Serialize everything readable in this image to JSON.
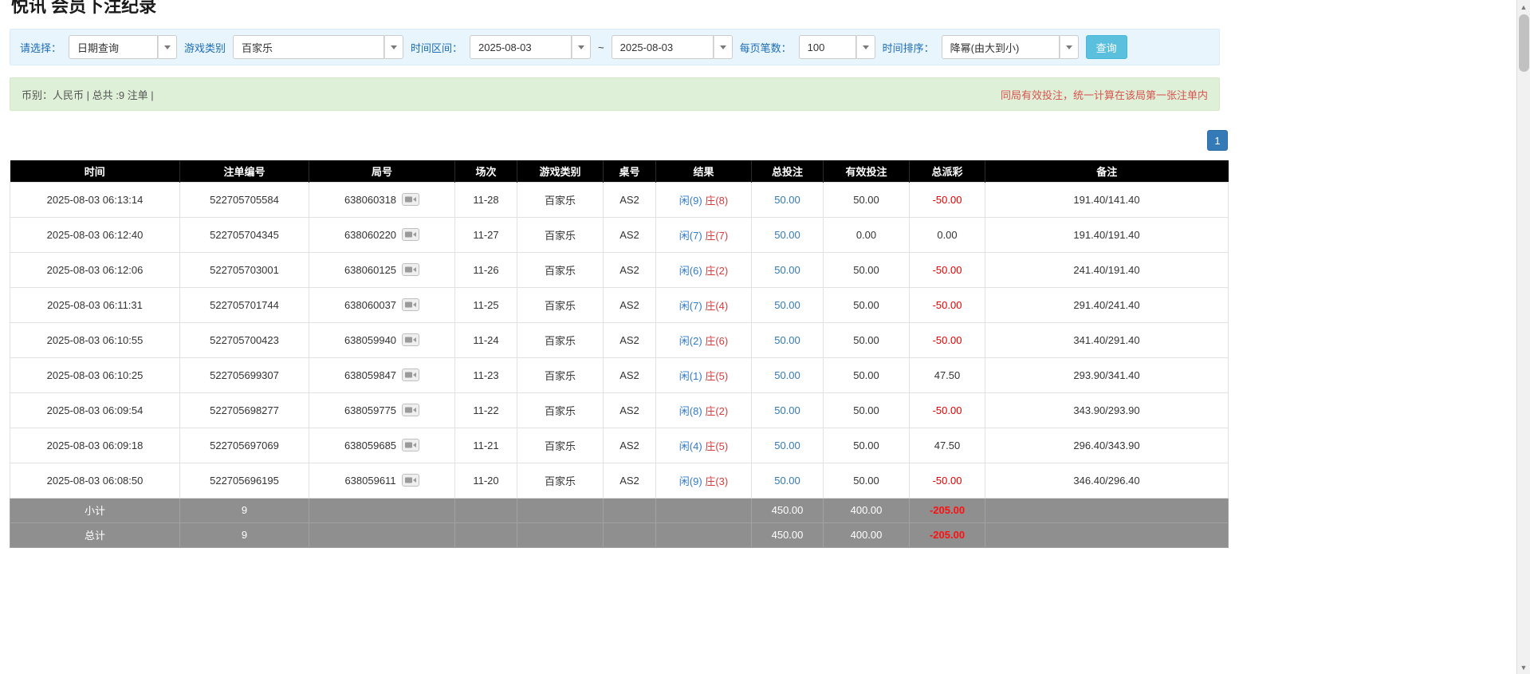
{
  "page": {
    "title": "悦讯 会员下注纪录"
  },
  "filter": {
    "select_label": "请选择：",
    "select_value": "日期查询",
    "game_label": "游戏类别",
    "game_value": "百家乐",
    "range_label": "时间区间：",
    "date_from": "2025-08-03",
    "range_separator": "~",
    "date_to": "2025-08-03",
    "page_size_label": "每页笔数：",
    "page_size_value": "100",
    "sort_label": "时间排序：",
    "sort_value": "降幂(由大到小)",
    "query_button": "查询"
  },
  "summary": {
    "info": "币别：人民币 | 总共 :9 注单 |",
    "notice": "同局有效投注，统一计算在该局第一张注单内"
  },
  "pagination": {
    "page": "1"
  },
  "table": {
    "headers": [
      "时间",
      "注单编号",
      "局号",
      "场次",
      "游戏类别",
      "桌号",
      "结果",
      "总投注",
      "有效投注",
      "总派彩",
      "备注"
    ],
    "rows": [
      {
        "time": "2025-08-03 06:13:14",
        "bet_id": "522705705584",
        "round_id": "638060318",
        "session": "11-28",
        "game": "百家乐",
        "table_id": "AS2",
        "player": "闲(9)",
        "banker": "庄(8)",
        "total_bet": "50.00",
        "valid_bet": "50.00",
        "payout": "-50.00",
        "remark": "191.40/141.40"
      },
      {
        "time": "2025-08-03 06:12:40",
        "bet_id": "522705704345",
        "round_id": "638060220",
        "session": "11-27",
        "game": "百家乐",
        "table_id": "AS2",
        "player": "闲(7)",
        "banker": "庄(7)",
        "total_bet": "50.00",
        "valid_bet": "0.00",
        "payout": "0.00",
        "remark": "191.40/191.40"
      },
      {
        "time": "2025-08-03 06:12:06",
        "bet_id": "522705703001",
        "round_id": "638060125",
        "session": "11-26",
        "game": "百家乐",
        "table_id": "AS2",
        "player": "闲(6)",
        "banker": "庄(2)",
        "total_bet": "50.00",
        "valid_bet": "50.00",
        "payout": "-50.00",
        "remark": "241.40/191.40"
      },
      {
        "time": "2025-08-03 06:11:31",
        "bet_id": "522705701744",
        "round_id": "638060037",
        "session": "11-25",
        "game": "百家乐",
        "table_id": "AS2",
        "player": "闲(7)",
        "banker": "庄(4)",
        "total_bet": "50.00",
        "valid_bet": "50.00",
        "payout": "-50.00",
        "remark": "291.40/241.40"
      },
      {
        "time": "2025-08-03 06:10:55",
        "bet_id": "522705700423",
        "round_id": "638059940",
        "session": "11-24",
        "game": "百家乐",
        "table_id": "AS2",
        "player": "闲(2)",
        "banker": "庄(6)",
        "total_bet": "50.00",
        "valid_bet": "50.00",
        "payout": "-50.00",
        "remark": "341.40/291.40"
      },
      {
        "time": "2025-08-03 06:10:25",
        "bet_id": "522705699307",
        "round_id": "638059847",
        "session": "11-23",
        "game": "百家乐",
        "table_id": "AS2",
        "player": "闲(1)",
        "banker": "庄(5)",
        "total_bet": "50.00",
        "valid_bet": "50.00",
        "payout": "47.50",
        "remark": "293.90/341.40"
      },
      {
        "time": "2025-08-03 06:09:54",
        "bet_id": "522705698277",
        "round_id": "638059775",
        "session": "11-22",
        "game": "百家乐",
        "table_id": "AS2",
        "player": "闲(8)",
        "banker": "庄(2)",
        "total_bet": "50.00",
        "valid_bet": "50.00",
        "payout": "-50.00",
        "remark": "343.90/293.90"
      },
      {
        "time": "2025-08-03 06:09:18",
        "bet_id": "522705697069",
        "round_id": "638059685",
        "session": "11-21",
        "game": "百家乐",
        "table_id": "AS2",
        "player": "闲(4)",
        "banker": "庄(5)",
        "total_bet": "50.00",
        "valid_bet": "50.00",
        "payout": "47.50",
        "remark": "296.40/343.90"
      },
      {
        "time": "2025-08-03 06:08:50",
        "bet_id": "522705696195",
        "round_id": "638059611",
        "session": "11-20",
        "game": "百家乐",
        "table_id": "AS2",
        "player": "闲(9)",
        "banker": "庄(3)",
        "total_bet": "50.00",
        "valid_bet": "50.00",
        "payout": "-50.00",
        "remark": "346.40/296.40"
      }
    ],
    "subtotal": {
      "label": "小计",
      "count": "9",
      "total_bet": "450.00",
      "valid_bet": "400.00",
      "payout": "-205.00"
    },
    "grand_total": {
      "label": "总计",
      "count": "9",
      "total_bet": "450.00",
      "valid_bet": "400.00",
      "payout": "-205.00"
    }
  },
  "colors": {
    "accent_blue": "#337ab7",
    "result_player_blue": "#2f7ac5",
    "result_banker_red": "#d43c3c",
    "negative_red": "#e60000",
    "query_button_blue": "#5bc0de",
    "header_bg": "#000000",
    "footer_bg": "#8f8f8f",
    "summary_bg": "#dff0d8",
    "filter_bg": "#e9f5fd"
  }
}
